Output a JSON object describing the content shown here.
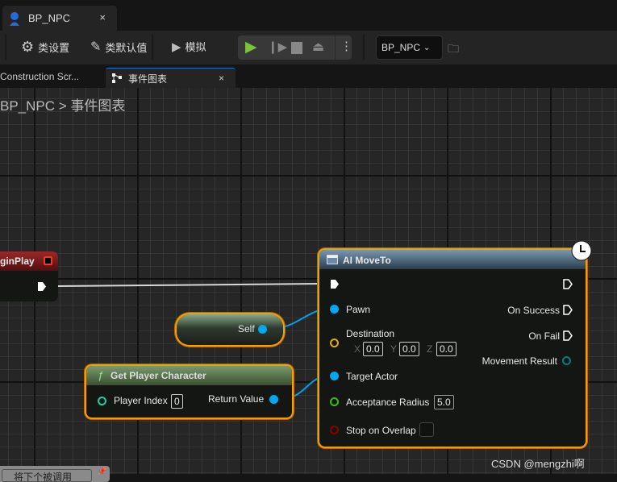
{
  "window": {
    "tab_title": "BP_NPC",
    "close": "×"
  },
  "toolbar": {
    "class_settings": "类设置",
    "class_defaults": "类默认值",
    "simulate": "模拟",
    "blueprint_selector": "BP_NPC"
  },
  "tabs": [
    {
      "label": "Construction Scr..."
    },
    {
      "label": "事件图表",
      "close": "×"
    }
  ],
  "breadcrumb": {
    "root": "BP_NPC",
    "sep": ">",
    "current": "事件图表"
  },
  "nodes": {
    "begin_play": {
      "title": "ginPlay"
    },
    "self": {
      "label": "Self"
    },
    "get_player_character": {
      "title": "Get Player Character",
      "icon": "ƒ",
      "player_index_label": "Player Index",
      "player_index_value": "0",
      "return_label": "Return Value"
    },
    "ai_moveto": {
      "title": "AI MoveTo",
      "pawn": "Pawn",
      "destination": "Destination",
      "x_label": "X",
      "x": "0.0",
      "y_label": "Y",
      "y": "0.0",
      "z_label": "Z",
      "z": "0.0",
      "target_actor": "Target Actor",
      "acceptance_radius": "Acceptance Radius",
      "acceptance_value": "5.0",
      "stop_on_overlap": "Stop on Overlap",
      "on_success": "On Success",
      "on_fail": "On Fail",
      "movement_result": "Movement Result"
    }
  },
  "comment": {
    "text": "将下个被调用"
  },
  "watermark": "CSDN @mengzhi啊",
  "colors": {
    "object_pin": "#00a8f0",
    "vector_pin": "#e0b000",
    "float_pin": "#3cc000",
    "bool_pin": "#8a0000",
    "int_pin": "#20d0a0",
    "enum_pin": "#008080",
    "selection": "#f0a000"
  }
}
